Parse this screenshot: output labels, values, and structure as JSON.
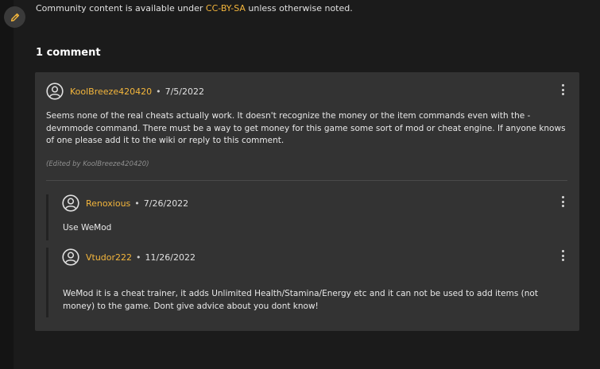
{
  "license": {
    "prefix": "Community content is available under ",
    "link": "CC-BY-SA",
    "suffix": " unless otherwise noted."
  },
  "comments_count": "1 comment",
  "thread": {
    "author": "KoolBreeze420420",
    "separator": "•",
    "date": "7/5/2022",
    "body": "Seems none of the real cheats actually work. It doesn't recognize the money or the item commands even with the -devmmode command. There must be a way to get money for this game some sort of mod or cheat engine. If anyone knows of one please add it to the wiki or reply to this comment.",
    "edited_note": "(Edited by KoolBreeze420420)"
  },
  "replies": [
    {
      "author": "Renoxious",
      "separator": "•",
      "date": "7/26/2022",
      "body": "Use WeMod"
    },
    {
      "author": "Vtudor222",
      "separator": "•",
      "date": "11/26/2022",
      "body": "WeMod it is a cheat trainer, it adds Unlimited Health/Stamina/Energy etc and it can not be used to add items (not money) to the game.  Dont give advice about you dont know!"
    }
  ],
  "icons": {
    "edit": "pencil-icon",
    "avatar": "user-avatar-icon",
    "menu": "more-vertical-icon"
  },
  "colors": {
    "accent": "#f4b63c",
    "panel": "#333333",
    "background": "#1b1b1b"
  }
}
